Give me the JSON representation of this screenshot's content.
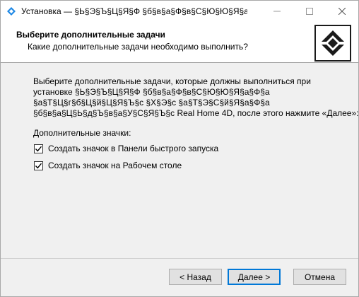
{
  "window": {
    "title": "Установка — §Ь§Э§Ъ§Ц§Я§Ф §б§в§а§Ф§в§С§Ю§Ю§Я§а§Ф§а §а§б..."
  },
  "header": {
    "title": "Выберите дополнительные задачи",
    "subtitle": "Какие дополнительные задачи необходимо выполнить?"
  },
  "content": {
    "description_lines": [
      "Выберите дополнительные задачи, которые должны выполниться при",
      "установке §Ь§Э§Ъ§Ц§Я§Ф §б§в§а§Ф§в§С§Ю§Ю§Я§а§Ф§а",
      "§а§Т§Ц§г§б§Ц§й§Ц§Я§Ъ§с §Х§Э§с §а§Т§Э§С§й§Я§а§Ф§а",
      "§б§в§а§Ц§Ь§д§Ъ§в§а§У§С§Я§Ъ§с Real Home 4D, после этого нажмите «Далее»:"
    ],
    "group_label": "Дополнительные значки:",
    "checkboxes": [
      {
        "label": "Создать значок в Панели быстрого запуска",
        "checked": true
      },
      {
        "label": "Создать значок на Рабочем столе",
        "checked": true
      }
    ]
  },
  "buttons": {
    "back": "< Назад",
    "next": "Далее >",
    "cancel": "Отмена"
  },
  "colors": {
    "accent": "#0078d7",
    "background": "#f0f0f0",
    "header_bg": "#ffffff"
  },
  "icons": {
    "app": "installer-icon",
    "logo": "real-home-logo"
  }
}
